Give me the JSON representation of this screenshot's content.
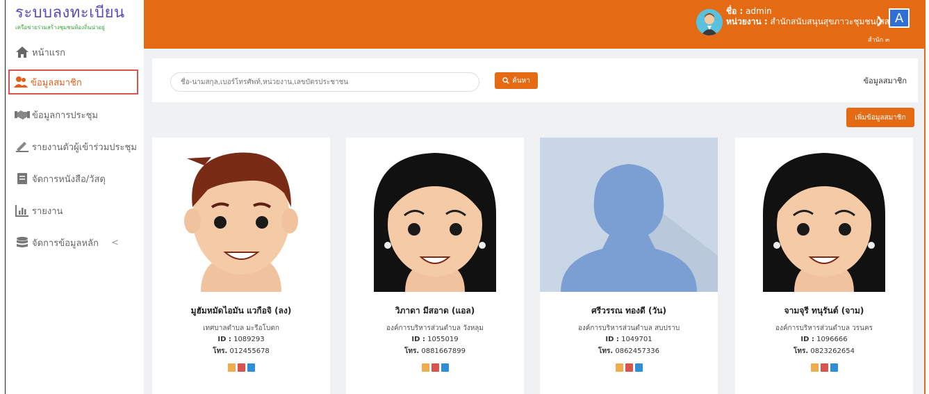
{
  "brand": {
    "title": "ระบบลงทะเบียน",
    "subtitle": "เครือข่ายร่วมสร้างชุมชนท้องถิ่นน่าอยู่"
  },
  "sidebar": {
    "items": [
      {
        "label": "หน้าแรก",
        "icon": "home-icon"
      },
      {
        "label": "ข้อมูลสมาชิก",
        "icon": "users-icon",
        "active": true
      },
      {
        "label": "ข้อมูลการประชุม",
        "icon": "handshake-icon"
      },
      {
        "label": "รายงานตัวผู้เข้าร่วมประชุม",
        "icon": "signature-icon"
      },
      {
        "label": "จัดการหนังสือ/วัสดุ",
        "icon": "book-icon"
      },
      {
        "label": "รายงาน",
        "icon": "bar-chart-icon"
      },
      {
        "label": "จัดการข้อมูลหลัก",
        "icon": "database-icon",
        "chevron": "<"
      }
    ]
  },
  "header": {
    "name_label": "ชื่อ :",
    "name_value": "admin",
    "unit_label": "หน่วยงาน :",
    "unit_value": "สำนักสนับสนุนสุขภาวะชุมชน(สสส.)",
    "office": "สำนัก ๓",
    "avatar_letter": "A"
  },
  "search": {
    "placeholder": "ชื่อ-นามสกุล,เบอร์โทรศัพท์,หน่วยงาน,เลขบัตรประชาชน",
    "button_label": "ค้นหา",
    "breadcrumb": "ข้อมูลสมาชิก"
  },
  "add_button": "เพิ่มข้อมูลสมาชิก",
  "members": [
    {
      "name": "มูฮัมหมัดไอมัน แวกือจิ (ลง)",
      "org": "เทศบาลตำบล มะรือโบตก",
      "id_label": "ID :",
      "id": "1089293",
      "tel_label": "โทร.",
      "tel": "012455678",
      "avatar": "male-cartoon"
    },
    {
      "name": "วิภาดา มีสอาด (แอล)",
      "org": "องค์การบริหารส่วนตำบล วังหลุม",
      "id_label": "ID :",
      "id": "1055019",
      "tel_label": "โทร.",
      "tel": "0881667899",
      "avatar": "female-cartoon"
    },
    {
      "name": "ศรีวรรณ ทองดี (วัน)",
      "org": "องค์การบริหารส่วนตำบล สบปราบ",
      "id_label": "ID :",
      "id": "1049701",
      "tel_label": "โทร.",
      "tel": "0862457336",
      "avatar": "silhouette"
    },
    {
      "name": "จามจุรี ทนุรันต์ (จาม)",
      "org": "องค์การบริหารส่วนตำบล วรนคร",
      "id_label": "ID :",
      "id": "1096666",
      "tel_label": "โทร.",
      "tel": "0823262654",
      "avatar": "female-cartoon"
    }
  ],
  "colors": {
    "accent": "#e46a14",
    "brand": "#5b4bb8",
    "active_border": "#d9534f"
  }
}
